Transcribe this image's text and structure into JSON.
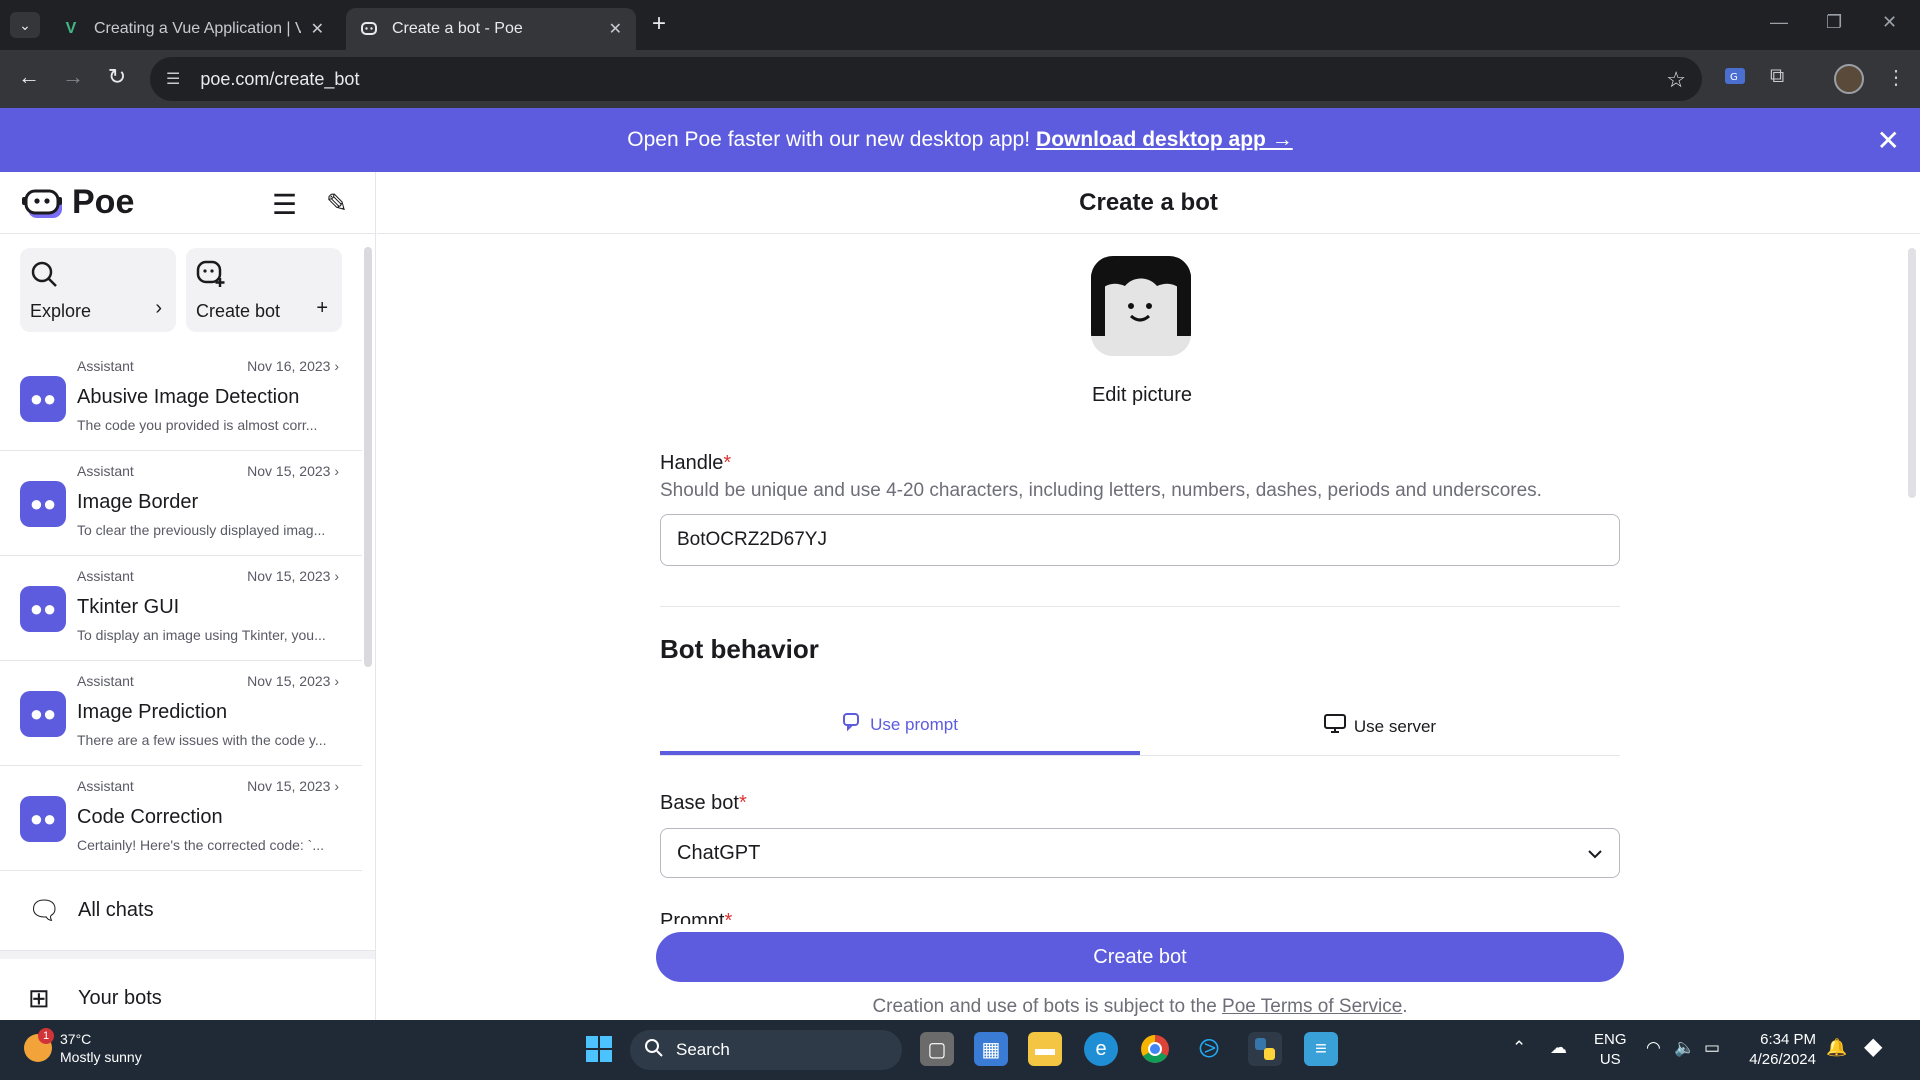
{
  "browser": {
    "tabs": [
      {
        "title": "Creating a Vue Application | Vu",
        "favicon": "vue-icon",
        "active": false
      },
      {
        "title": "Create a bot - Poe",
        "favicon": "poe-icon",
        "active": true
      }
    ],
    "url": "poe.com/create_bot"
  },
  "banner": {
    "text": "Open Poe faster with our new desktop app!",
    "link": "Download desktop app →"
  },
  "sidebar": {
    "logo": "Poe",
    "explore": "Explore",
    "create_bot": "Create bot",
    "chats": [
      {
        "bot": "Assistant",
        "date": "Nov 16, 2023",
        "title": "Abusive Image Detection",
        "preview": "The code you provided is almost corr..."
      },
      {
        "bot": "Assistant",
        "date": "Nov 15, 2023",
        "title": "Image Border",
        "preview": "To clear the previously displayed imag..."
      },
      {
        "bot": "Assistant",
        "date": "Nov 15, 2023",
        "title": "Tkinter GUI",
        "preview": "To display an image using Tkinter, you..."
      },
      {
        "bot": "Assistant",
        "date": "Nov 15, 2023",
        "title": "Image Prediction",
        "preview": "There are a few issues with the code y..."
      },
      {
        "bot": "Assistant",
        "date": "Nov 15, 2023",
        "title": "Code Correction",
        "preview": "Certainly! Here's the corrected code: `..."
      }
    ],
    "all_chats": "All chats",
    "your_bots": "Your bots"
  },
  "main": {
    "title": "Create a bot",
    "edit_picture": "Edit picture",
    "handle_label": "Handle",
    "handle_hint": "Should be unique and use 4-20 characters, including letters, numbers, dashes, periods and underscores.",
    "handle_value": "BotOCRZ2D67YJ",
    "section_title": "Bot behavior",
    "tab_prompt": "Use prompt",
    "tab_server": "Use server",
    "base_bot_label": "Base bot",
    "base_bot_value": "ChatGPT",
    "prompt_label": "Prompt",
    "create_button": "Create bot",
    "terms_text": "Creation and use of bots is subject to the",
    "terms_link": "Poe Terms of Service",
    "terms_end": "."
  },
  "taskbar": {
    "temperature": "37°C",
    "weather": "Mostly sunny",
    "weather_badge": "1",
    "search": "Search",
    "lang1": "ENG",
    "lang2": "US",
    "time": "6:34 PM",
    "date": "4/26/2024"
  },
  "colors": {
    "accent": "#5d5cde",
    "taskbar": "#1f2a36"
  }
}
